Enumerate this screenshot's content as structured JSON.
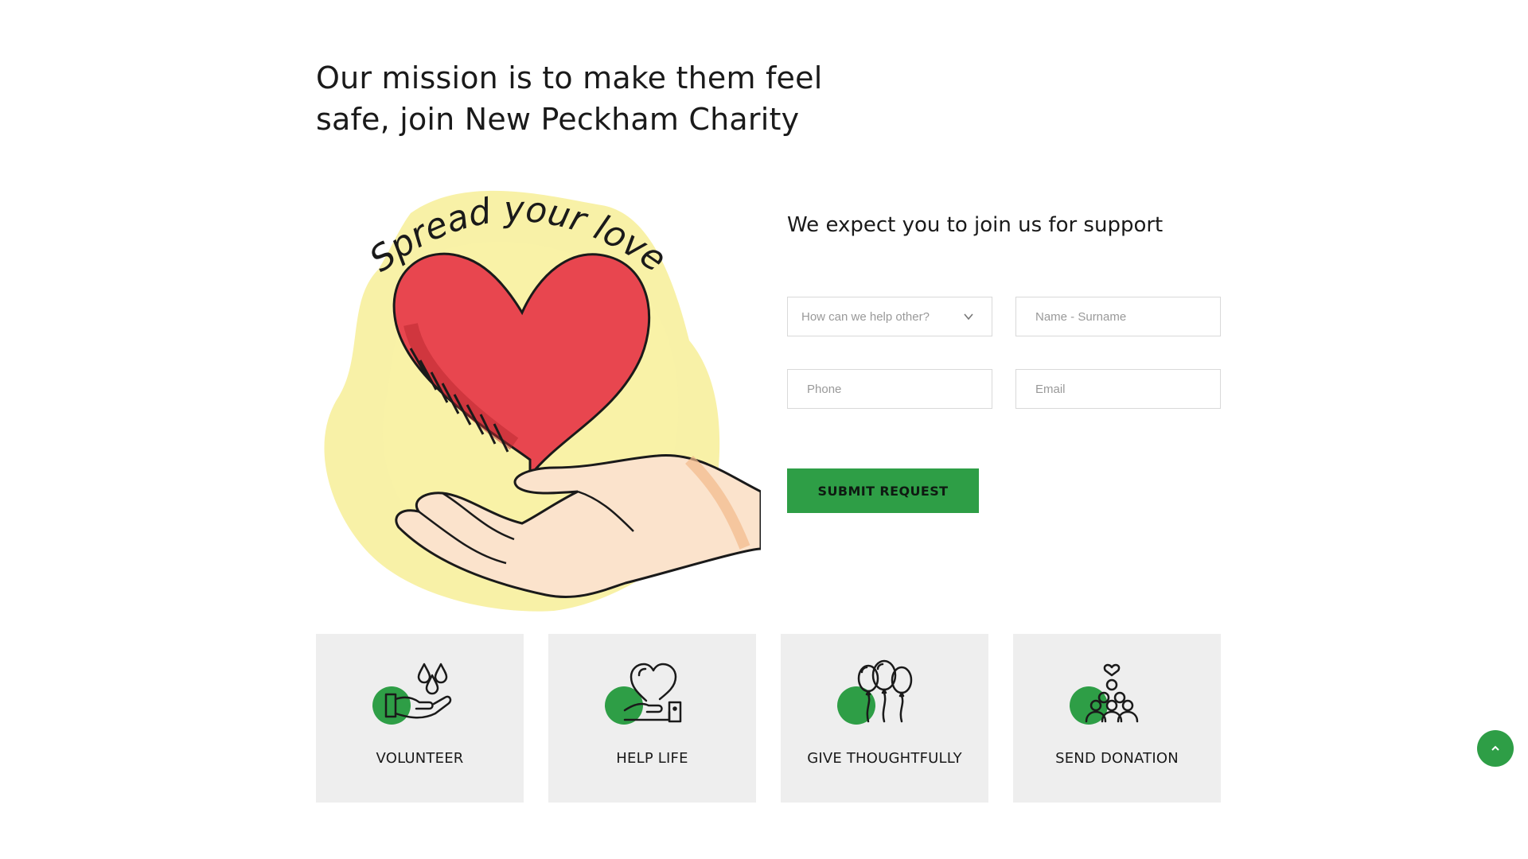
{
  "hero": {
    "headline_line1": "Our mission is to make them feel",
    "headline_line2": "safe, join New Peckham Charity",
    "illustration_caption": "Spread your love"
  },
  "form": {
    "title": "We expect you to join us for support",
    "help_select": {
      "value": "How can we help other?",
      "icon": "chevron-down-icon"
    },
    "name_placeholder": "Name - Surname",
    "phone_placeholder": "Phone",
    "email_placeholder": "Email",
    "submit_label": "SUBMIT REQUEST"
  },
  "cards": [
    {
      "label": "VOLUNTEER",
      "icon": "helping-hand-drops-icon"
    },
    {
      "label": "HELP LIFE",
      "icon": "heart-in-hand-icon"
    },
    {
      "label": "GIVE THOUGHTFULLY",
      "icon": "balloons-icon"
    },
    {
      "label": "SEND DONATION",
      "icon": "community-people-icon"
    }
  ],
  "colors": {
    "accent_green": "#2e9e46",
    "card_bg": "#eeeeee",
    "heart_red": "#e8464f",
    "splash_yellow": "#f5ec8a"
  },
  "back_to_top": {
    "icon": "chevron-up-icon"
  }
}
